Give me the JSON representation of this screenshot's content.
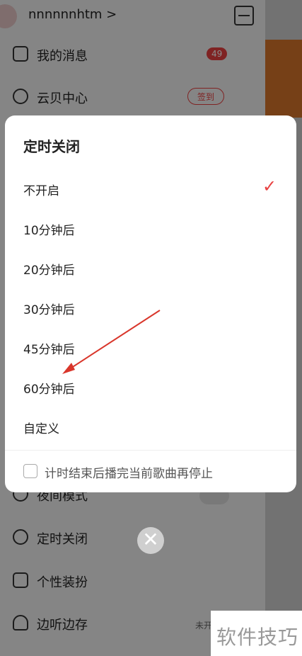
{
  "background": {
    "username": "nnnnnnhtm >",
    "menu": [
      {
        "label": "我的消息",
        "icon": "mail-icon"
      },
      {
        "label": "云贝中心",
        "icon": "coin-icon"
      },
      {
        "label": "夜间模式",
        "icon": "moon-icon"
      },
      {
        "label": "定时关闭",
        "icon": "timer-icon"
      },
      {
        "label": "个性装扮",
        "icon": "shirt-icon"
      },
      {
        "label": "边听边存",
        "icon": "headphones-icon"
      }
    ],
    "messages_badge": "49",
    "sign_label": "签到",
    "bottom_right_meta": "未开"
  },
  "modal": {
    "title": "定时关闭",
    "options": [
      {
        "label": "不开启",
        "selected": true
      },
      {
        "label": "10分钟后",
        "selected": false
      },
      {
        "label": "20分钟后",
        "selected": false
      },
      {
        "label": "30分钟后",
        "selected": false
      },
      {
        "label": "45分钟后",
        "selected": false
      },
      {
        "label": "60分钟后",
        "selected": false
      },
      {
        "label": "自定义",
        "selected": false
      }
    ],
    "check_glyph": "✓",
    "footer_checkbox_label": "计时结束后播完当前歌曲再停止"
  },
  "close_glyph": "✕",
  "watermark": "软件技巧",
  "colors": {
    "accent": "#e84141"
  }
}
